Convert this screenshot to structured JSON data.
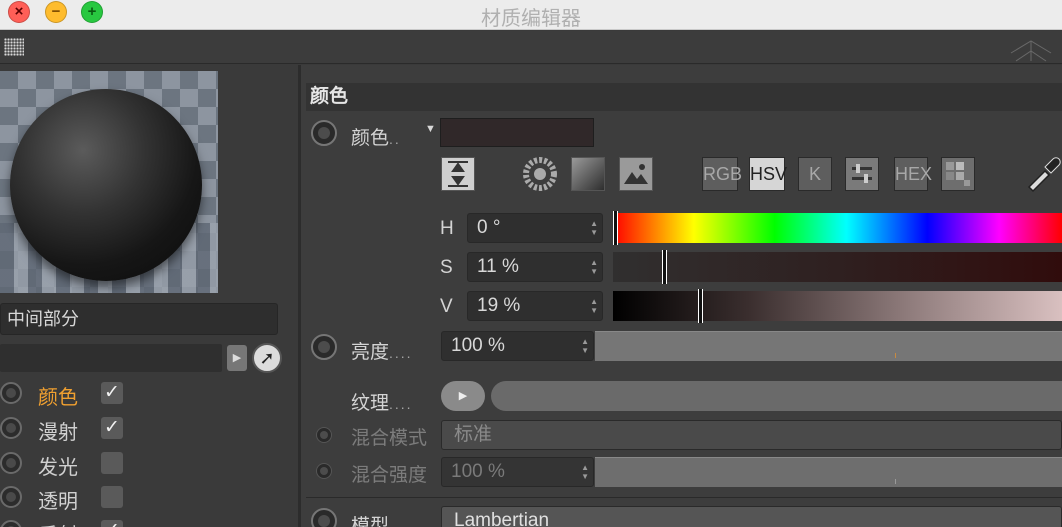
{
  "window": {
    "title": "材质编辑器"
  },
  "colors": {
    "accent_active": "#f0a030",
    "swatch": "#302829"
  },
  "left": {
    "material_name": "中间部分",
    "channels": [
      {
        "label": "颜色",
        "checked": true,
        "active": true
      },
      {
        "label": "漫射",
        "checked": true,
        "active": false
      },
      {
        "label": "发光",
        "checked": false,
        "active": false
      },
      {
        "label": "透明",
        "checked": false,
        "active": false
      },
      {
        "label": "反射",
        "checked": true,
        "active": false
      }
    ],
    "check_mark": "✓"
  },
  "color_section": {
    "header": "颜色",
    "color_label": "颜色",
    "color_dots": "..",
    "modes": [
      "RGB",
      "HSV",
      "K",
      "HEX"
    ],
    "active_mode": "HSV",
    "h": {
      "label": "H",
      "value": "0 °",
      "fraction": 0.0
    },
    "s": {
      "label": "S",
      "value": "11 %",
      "fraction": 0.11
    },
    "v": {
      "label": "V",
      "value": "19 %",
      "fraction": 0.19
    },
    "brightness": {
      "label": "亮度",
      "dots": "....",
      "value": "100 %"
    },
    "texture": {
      "label": "纹理",
      "dots": "...."
    },
    "blend_mode": {
      "label": "混合模式",
      "value": "标准"
    },
    "blend_strength": {
      "label": "混合强度",
      "value": "100 %"
    },
    "model": {
      "label": "模型",
      "value": "Lambertian"
    }
  }
}
